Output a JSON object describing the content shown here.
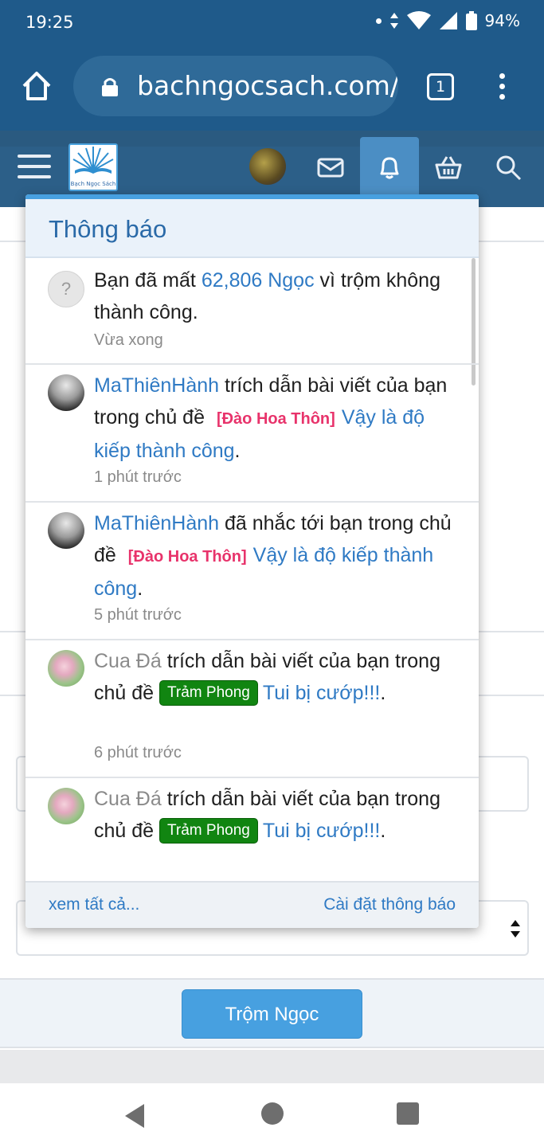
{
  "status_bar": {
    "time": "19:25",
    "battery": "94%"
  },
  "browser": {
    "url": "bachngocsach.com/",
    "tab_count": "1"
  },
  "site": {
    "logo_caption": "Bạch Ngọc Sách"
  },
  "page_background": {
    "submit_label": "Trộm Ngọc"
  },
  "notifications_panel": {
    "title": "Thông báo",
    "items": [
      {
        "avatar": "question-avatar",
        "avatar_text": "?",
        "text_before": "Bạn đã mất ",
        "link": "62,806 Ngọc",
        "text_after": " vì trộm không thành công.",
        "time": "Vừa xong"
      },
      {
        "avatar": "user-avatar",
        "user": "MaThiênHành",
        "action": " trích dẫn bài viết của bạn trong chủ đề ",
        "prefix": "[Đào Hoa Thôn]",
        "thread": "Vậy là độ kiếp thành công",
        "suffix": ".",
        "time": "1 phút trước"
      },
      {
        "avatar": "user-avatar",
        "user": "MaThiênHành",
        "action": " đã nhắc tới bạn trong chủ đề ",
        "prefix": "[Đào Hoa Thôn]",
        "thread": "Vậy là độ kiếp thành công",
        "suffix": ".",
        "time": "5 phút trước"
      },
      {
        "avatar": "user-avatar",
        "user": "Cua Đá",
        "action": " trích dẫn bài viết của bạn trong chủ đề ",
        "prefix": "Trảm Phong",
        "thread": "Tui bị cướp!!!",
        "suffix": ".",
        "time": "6 phút trước"
      },
      {
        "avatar": "user-avatar",
        "user": "Cua Đá",
        "action": " trích dẫn bài viết của bạn trong chủ đề ",
        "prefix": "Trảm Phong",
        "thread": "Tui bị cướp!!!",
        "suffix": "."
      }
    ],
    "footer_left": "xem tất cả...",
    "footer_right": "Cài đặt thông báo"
  },
  "colors": {
    "browser_blue": "#1f5a8a",
    "header_blue": "#2c5f88",
    "link_blue": "#2f7ac4",
    "prefix_red": "#e8336b",
    "prefix_green": "#118511",
    "button_blue": "#47a0e0"
  }
}
